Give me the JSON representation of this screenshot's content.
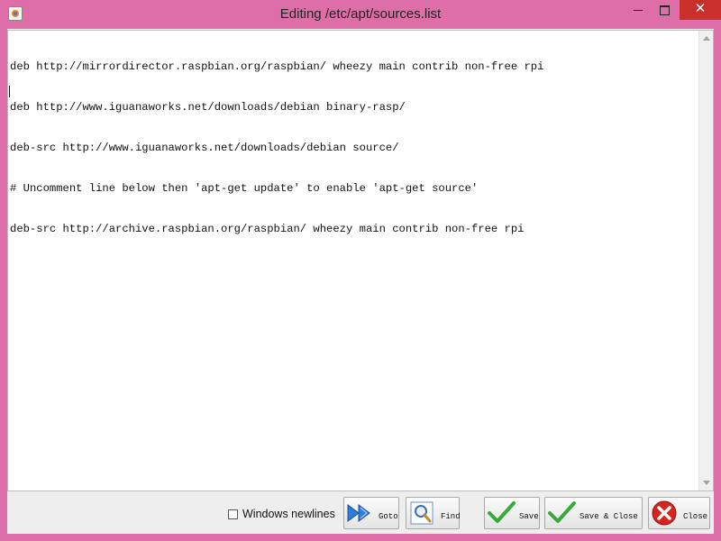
{
  "window": {
    "title": "Editing /etc/apt/sources.list",
    "close_glyph": "✕"
  },
  "editor": {
    "lines": [
      "deb http://mirrordirector.raspbian.org/raspbian/ wheezy main contrib non-free rpi",
      "deb http://www.iguanaworks.net/downloads/debian binary-rasp/",
      "deb-src http://www.iguanaworks.net/downloads/debian source/",
      "# Uncomment line below then 'apt-get update' to enable 'apt-get source'",
      "deb-src http://archive.raspbian.org/raspbian/ wheezy main contrib non-free rpi"
    ]
  },
  "toolbar": {
    "windows_newlines_label": "Windows newlines",
    "windows_newlines_checked": false,
    "goto_label": "Goto",
    "find_label": "Find",
    "save_label": "Save",
    "save_close_label": "Save & Close",
    "close_label": "Close"
  },
  "icons": {
    "goto": "double-arrow-right-icon",
    "find": "magnifier-icon",
    "save": "checkmark-icon",
    "save_close": "checkmark-icon",
    "close": "red-x-icon"
  },
  "colors": {
    "window_frame": "#dd6ea8",
    "close_button": "#c9302c",
    "checkmark": "#3aa83a",
    "goto_arrow": "#2f7fd8",
    "close_icon": "#d9231d"
  }
}
